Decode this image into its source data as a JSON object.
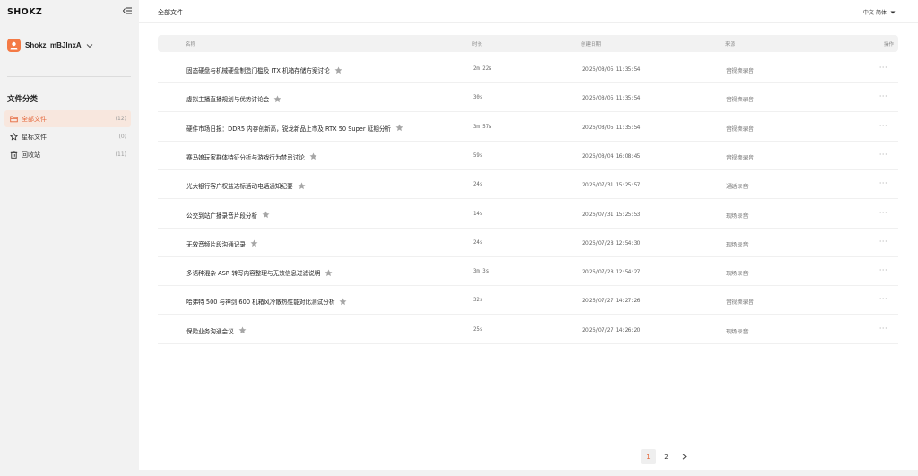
{
  "app": {
    "logo": "SHOKZ"
  },
  "user": {
    "name": "Shokz_mBJlnxA"
  },
  "sidebar": {
    "section_title": "文件分类",
    "items": [
      {
        "label": "全部文件",
        "count": "(12)",
        "icon": "folder-icon",
        "active": true
      },
      {
        "label": "星标文件",
        "count": "(0)",
        "icon": "star-icon",
        "active": false
      },
      {
        "label": "回收站",
        "count": "(11)",
        "icon": "trash-icon",
        "active": false
      }
    ]
  },
  "header": {
    "title": "全部文件",
    "language": "中文-简体"
  },
  "table": {
    "columns": [
      "名称",
      "时长",
      "创建日期",
      "来源",
      "操作"
    ],
    "rows": [
      {
        "name": "固态硬盘与机械硬盘制造门槛及 ITX 机箱存储方案讨论",
        "duration": "2m 22s",
        "date": "2026/08/05 11:35:54",
        "source": "音视频录音"
      },
      {
        "name": "虚拟主播直播规划与优势讨论会",
        "duration": "30s",
        "date": "2026/08/05 11:35:54",
        "source": "音视频录音"
      },
      {
        "name": "硬件市场日报：DDR5 内存创新高，锐龙新品上市及 RTX 50 Super 延期分析",
        "duration": "3m 57s",
        "date": "2026/08/05 11:35:54",
        "source": "音视频录音"
      },
      {
        "name": "赛马娘玩家群体特征分析与游戏行为禁忌讨论",
        "duration": "59s",
        "date": "2026/08/04 16:08:45",
        "source": "音视频录音"
      },
      {
        "name": "光大银行客户权益达标活动电话通知纪要",
        "duration": "24s",
        "date": "2026/07/31 15:25:57",
        "source": "通话录音"
      },
      {
        "name": "公交到站广播录音片段分析",
        "duration": "14s",
        "date": "2026/07/31 15:25:53",
        "source": "现场录音"
      },
      {
        "name": "无效音频片段沟通记录",
        "duration": "24s",
        "date": "2026/07/28 12:54:30",
        "source": "现场录音"
      },
      {
        "name": "多语种混杂 ASR 转写内容整理与无效信息过滤说明",
        "duration": "3m 3s",
        "date": "2026/07/28 12:54:27",
        "source": "现场录音"
      },
      {
        "name": "哈弗特 500 与神剑 600 机箱风冷散热性能对比测试分析",
        "duration": "32s",
        "date": "2026/07/27 14:27:26",
        "source": "音视频录音"
      },
      {
        "name": "保险业务沟通会议",
        "duration": "25s",
        "date": "2026/07/27 14:26:20",
        "source": "现场录音"
      }
    ]
  },
  "pagination": {
    "pages": [
      "1",
      "2"
    ],
    "current": "1"
  },
  "colors": {
    "accent": "#e5673b",
    "active_bg": "#f8e7de",
    "avatar": "#f47a45"
  }
}
